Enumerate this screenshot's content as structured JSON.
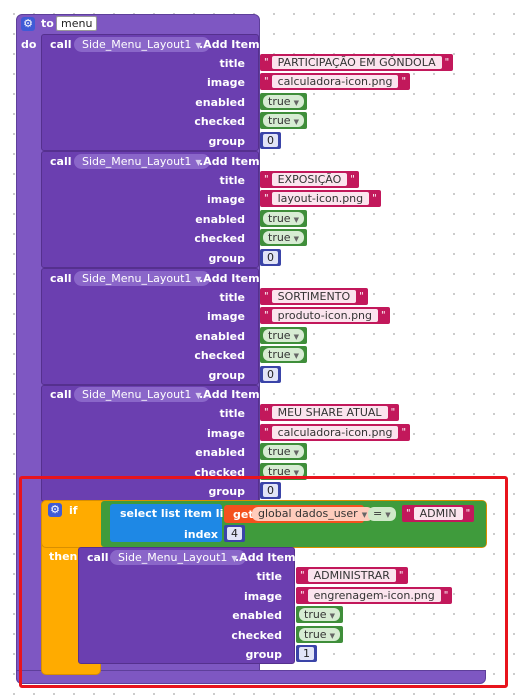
{
  "procedure": {
    "keyword_to": "to",
    "name": "menu",
    "keyword_do": "do"
  },
  "call_blocks": [
    {
      "call": "call",
      "component": "Side_Menu_Layout1",
      "method": ".Add Item",
      "labels": {
        "title": "title",
        "image": "image",
        "enabled": "enabled",
        "checked": "checked",
        "group": "group"
      },
      "title": "PARTICIPAÇÃO EM GÔNDOLA",
      "image": "calculadora-icon.png",
      "enabled": "true",
      "checked": "true",
      "group": "0"
    },
    {
      "call": "call",
      "component": "Side_Menu_Layout1",
      "method": ".Add Item",
      "labels": {
        "title": "title",
        "image": "image",
        "enabled": "enabled",
        "checked": "checked",
        "group": "group"
      },
      "title": "EXPOSIÇÃO",
      "image": "layout-icon.png",
      "enabled": "true",
      "checked": "true",
      "group": "0"
    },
    {
      "call": "call",
      "component": "Side_Menu_Layout1",
      "method": ".Add Item",
      "labels": {
        "title": "title",
        "image": "image",
        "enabled": "enabled",
        "checked": "checked",
        "group": "group"
      },
      "title": "SORTIMENTO",
      "image": "produto-icon.png",
      "enabled": "true",
      "checked": "true",
      "group": "0"
    },
    {
      "call": "call",
      "component": "Side_Menu_Layout1",
      "method": ".Add Item",
      "labels": {
        "title": "title",
        "image": "image",
        "enabled": "enabled",
        "checked": "checked",
        "group": "group"
      },
      "title": "MEU SHARE ATUAL",
      "image": "calculadora-icon.png",
      "enabled": "true",
      "checked": "true",
      "group": "0"
    }
  ],
  "if_block": {
    "keyword_if": "if",
    "keyword_then": "then",
    "select": {
      "label": "select list item  list",
      "index_label": "index",
      "index_value": "4"
    },
    "get": {
      "keyword": "get",
      "variable": "global dados_user"
    },
    "operator": "=",
    "compare_value": "ADMIN",
    "inner_call": {
      "call": "call",
      "component": "Side_Menu_Layout1",
      "method": ".Add Item",
      "labels": {
        "title": "title",
        "image": "image",
        "enabled": "enabled",
        "checked": "checked",
        "group": "group"
      },
      "title": "ADMINISTRAR",
      "image": "engrenagem-icon.png",
      "enabled": "true",
      "checked": "true",
      "group": "1"
    }
  },
  "icons": {
    "gear": "gear-icon",
    "dropdown": "chevron-down-icon"
  },
  "colors": {
    "procedure": "#7e57c2",
    "call": "#6b3fb0",
    "text": "#c2185b",
    "logic": "#3f8e3a",
    "math": "#3a44a8",
    "control": "#ffab00",
    "list": "#1e88e5",
    "variable": "#f4511e",
    "highlight": "#e8141d"
  }
}
